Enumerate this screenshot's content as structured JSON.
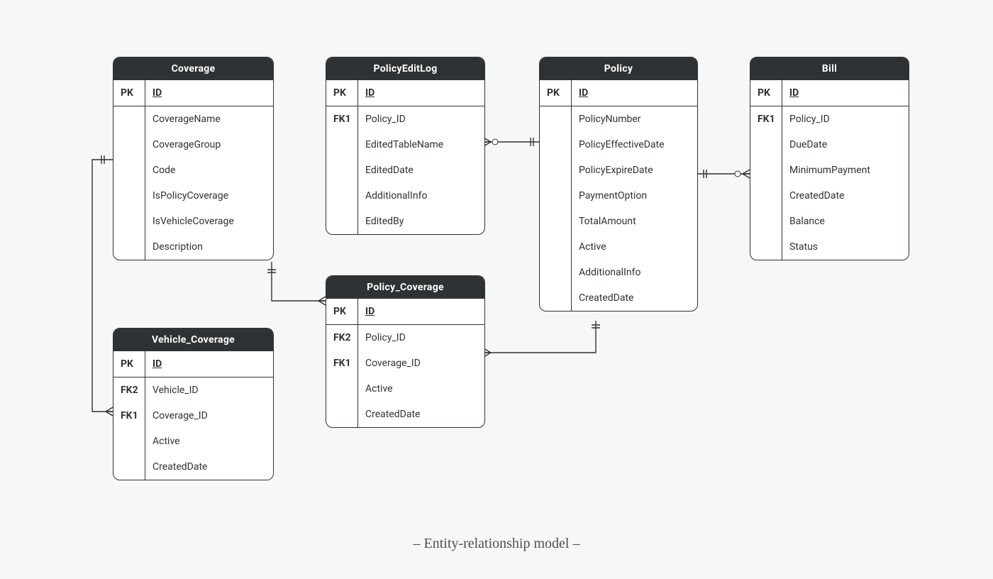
{
  "caption": "– Entity-relationship model –",
  "entities": {
    "coverage": {
      "title": "Coverage",
      "pk_key": "PK",
      "pk_field": "ID",
      "rows": [
        {
          "key": "",
          "field": "CoverageName"
        },
        {
          "key": "",
          "field": "CoverageGroup"
        },
        {
          "key": "",
          "field": "Code"
        },
        {
          "key": "",
          "field": "IsPolicyCoverage"
        },
        {
          "key": "",
          "field": "IsVehicleCoverage"
        },
        {
          "key": "",
          "field": "Description"
        }
      ]
    },
    "policyEditLog": {
      "title": "PolicyEditLog",
      "pk_key": "PK",
      "pk_field": "ID",
      "rows": [
        {
          "key": "FK1",
          "field": "Policy_ID"
        },
        {
          "key": "",
          "field": "EditedTableName"
        },
        {
          "key": "",
          "field": "EditedDate"
        },
        {
          "key": "",
          "field": "AdditionalInfo"
        },
        {
          "key": "",
          "field": "EditedBy"
        }
      ]
    },
    "policy": {
      "title": "Policy",
      "pk_key": "PK",
      "pk_field": "ID",
      "rows": [
        {
          "key": "",
          "field": "PolicyNumber"
        },
        {
          "key": "",
          "field": "PolicyEffectiveDate"
        },
        {
          "key": "",
          "field": "PolicyExpireDate"
        },
        {
          "key": "",
          "field": "PaymentOption"
        },
        {
          "key": "",
          "field": "TotalAmount"
        },
        {
          "key": "",
          "field": "Active"
        },
        {
          "key": "",
          "field": "AdditionalInfo"
        },
        {
          "key": "",
          "field": "CreatedDate"
        }
      ]
    },
    "bill": {
      "title": "Bill",
      "pk_key": "PK",
      "pk_field": "ID",
      "rows": [
        {
          "key": "FK1",
          "field": "Policy_ID"
        },
        {
          "key": "",
          "field": "DueDate"
        },
        {
          "key": "",
          "field": "MinimumPayment"
        },
        {
          "key": "",
          "field": "CreatedDate"
        },
        {
          "key": "",
          "field": "Balance"
        },
        {
          "key": "",
          "field": "Status"
        }
      ]
    },
    "policyCoverage": {
      "title": "Policy_Coverage",
      "pk_key": "PK",
      "pk_field": "ID",
      "rows": [
        {
          "key": "FK2",
          "field": "Policy_ID"
        },
        {
          "key": "FK1",
          "field": "Coverage_ID"
        },
        {
          "key": "",
          "field": "Active"
        },
        {
          "key": "",
          "field": "CreatedDate"
        }
      ]
    },
    "vehicleCoverage": {
      "title": "Vehicle_Coverage",
      "pk_key": "PK",
      "pk_field": "ID",
      "rows": [
        {
          "key": "FK2",
          "field": "Vehicle_ID"
        },
        {
          "key": "FK1",
          "field": "Coverage_ID"
        },
        {
          "key": "",
          "field": "Active"
        },
        {
          "key": "",
          "field": "CreatedDate"
        }
      ]
    }
  },
  "relationships": [
    {
      "from": "PolicyEditLog",
      "to": "Policy",
      "cardinality": "many-to-one"
    },
    {
      "from": "Policy",
      "to": "Bill",
      "cardinality": "one-to-many"
    },
    {
      "from": "Policy_Coverage",
      "to": "Policy",
      "cardinality": "many-to-one"
    },
    {
      "from": "Policy_Coverage",
      "to": "Coverage",
      "cardinality": "many-to-one"
    },
    {
      "from": "Vehicle_Coverage",
      "to": "Coverage",
      "cardinality": "many-to-one"
    }
  ]
}
